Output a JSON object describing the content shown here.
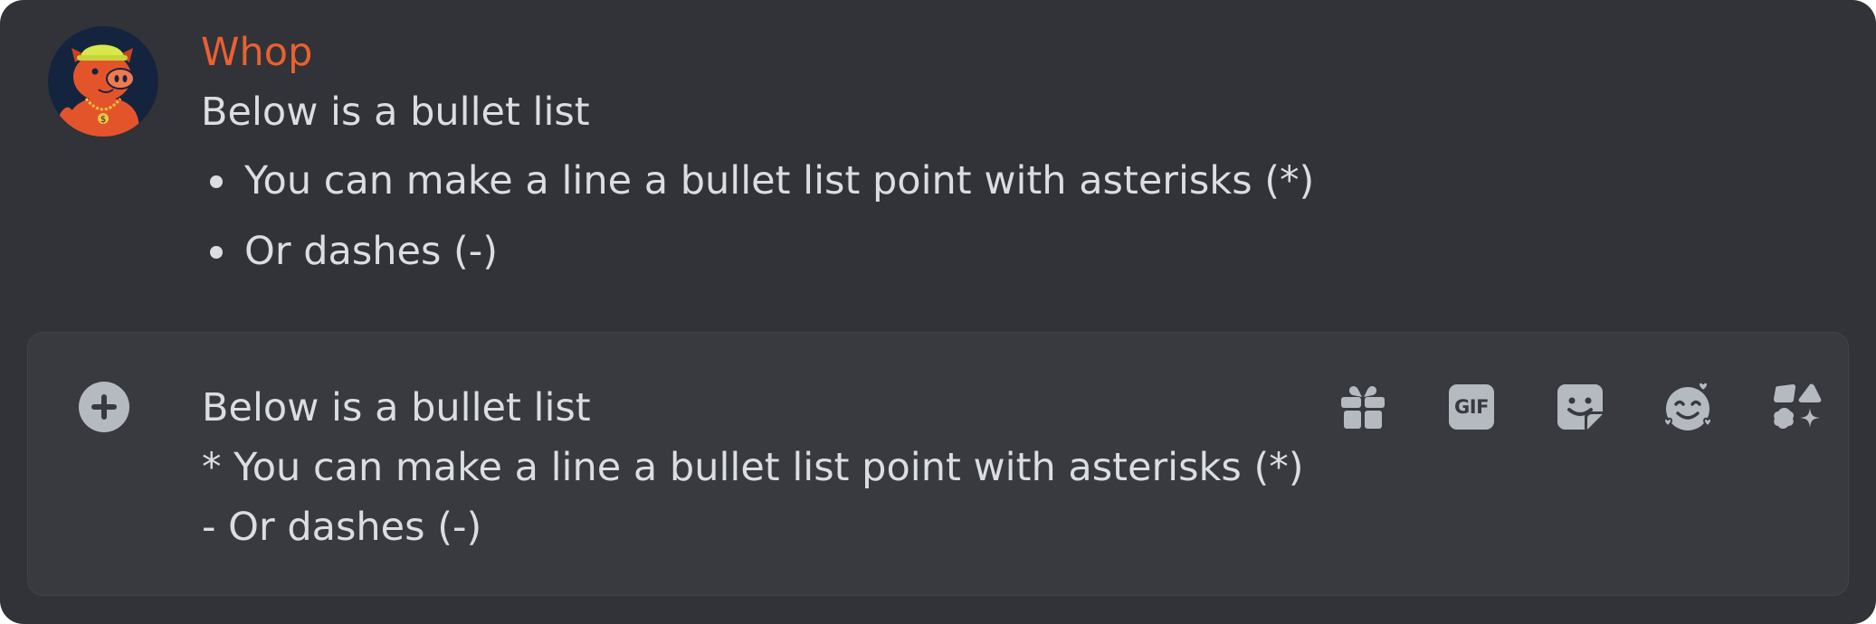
{
  "message": {
    "author": "Whop",
    "author_color": "#e9612f",
    "text": "Below is a bullet list",
    "bullets": [
      "You can make a line a bullet list point with asterisks (*)",
      "Or dashes (-)"
    ]
  },
  "composer": {
    "lines": [
      "Below is a bullet list",
      "* You can make a line a bullet list point with asterisks (*)",
      "- Or dashes (-)"
    ],
    "tools": {
      "gift": "gift-icon",
      "gif_label": "GIF",
      "sticker": "sticker-icon",
      "emoji": "emoji-icon",
      "apps": "apps-icon"
    }
  },
  "colors": {
    "background": "#313338",
    "composer_background": "#383a40",
    "text": "#dcdde1",
    "icon": "#b5bac1"
  }
}
